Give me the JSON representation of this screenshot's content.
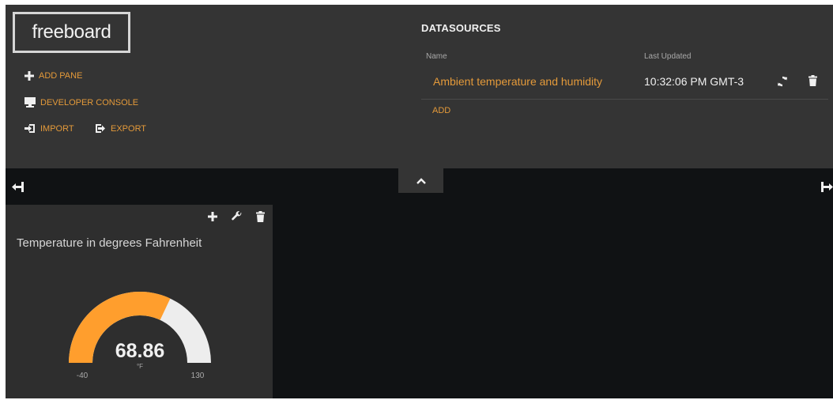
{
  "header": {
    "logo": "freeboard",
    "menu": {
      "add_pane": "ADD PANE",
      "developer_console": "DEVELOPER CONSOLE",
      "import": "IMPORT",
      "export": "EXPORT"
    }
  },
  "datasources": {
    "title": "DATASOURCES",
    "columns": {
      "name": "Name",
      "last_updated": "Last Updated"
    },
    "rows": [
      {
        "name": "Ambient temperature and humidity",
        "last_updated": "10:32:06 PM GMT-3"
      }
    ],
    "add_label": "ADD"
  },
  "pane": {
    "title": "Temperature in degrees Fahrenheit",
    "gauge": {
      "value": 68.86,
      "value_text": "68.86",
      "unit": "°F",
      "min": -40,
      "max": 130,
      "min_text": "-40",
      "max_text": "130"
    }
  },
  "colors": {
    "accent": "#e49a3a",
    "gauge_fill": "#ff9e2d",
    "gauge_track": "#ededed",
    "background": "#101214",
    "panel": "#343434"
  },
  "icons": {
    "add": "plus-icon",
    "console": "monitor-icon",
    "import": "import-icon",
    "export": "export-icon",
    "refresh": "refresh-icon",
    "delete": "trash-icon",
    "collapse": "chevron-up-icon",
    "shrink": "arrow-left-bar-icon",
    "expand": "bar-arrow-right-icon",
    "settings": "wrench-icon"
  }
}
